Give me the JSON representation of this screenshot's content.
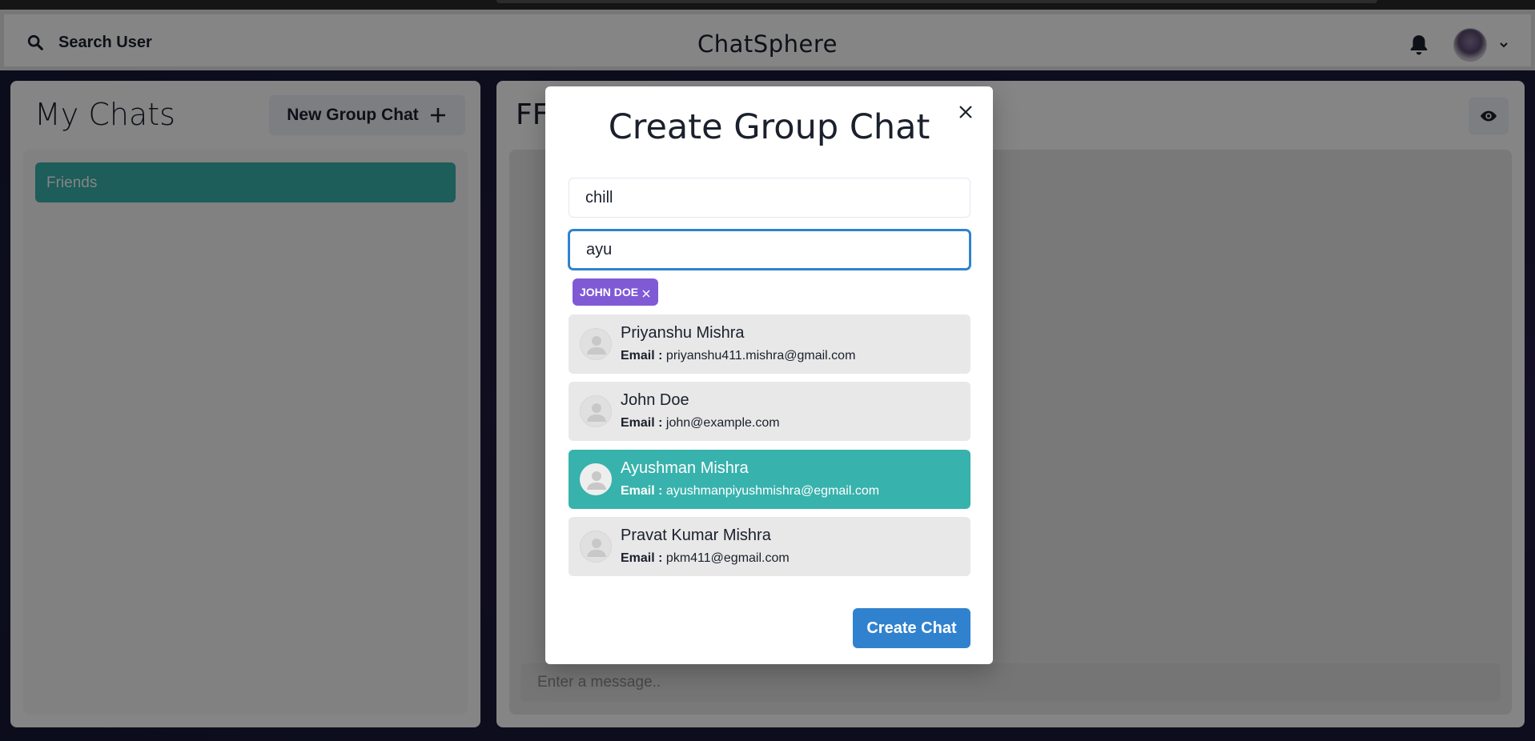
{
  "header": {
    "search_label": "Search User",
    "app_title": "ChatSphere"
  },
  "my_chats": {
    "title": "My Chats",
    "new_group_label": "New Group Chat",
    "chats": [
      {
        "name": "Friends"
      }
    ]
  },
  "chat_box": {
    "chat_name": "FF",
    "message_placeholder": "Enter a message.."
  },
  "modal": {
    "title": "Create Group Chat",
    "chat_name_value": "chill",
    "user_search_value": "ayu",
    "selected_users": [
      {
        "label": "JOHN DOE"
      }
    ],
    "search_results": [
      {
        "name": "Priyanshu Mishra",
        "email_label": "Email :",
        "email": "priyanshu411.mishra@gmail.com",
        "highlighted": false
      },
      {
        "name": "John Doe",
        "email_label": "Email :",
        "email": "john@example.com",
        "highlighted": false
      },
      {
        "name": "Ayushman Mishra",
        "email_label": "Email :",
        "email": "ayushmanpiyushmishra@egmail.com",
        "highlighted": true
      },
      {
        "name": "Pravat Kumar Mishra",
        "email_label": "Email :",
        "email": "pkm411@egmail.com",
        "highlighted": false
      }
    ],
    "create_label": "Create Chat"
  },
  "colors": {
    "teal": "#38b2ac",
    "blue": "#3182ce",
    "purple_badge": "#805ad5"
  },
  "icons": [
    "search-icon",
    "bell-icon",
    "chevron-down-icon",
    "plus-icon",
    "eye-icon",
    "close-icon",
    "user-avatar-icon"
  ]
}
